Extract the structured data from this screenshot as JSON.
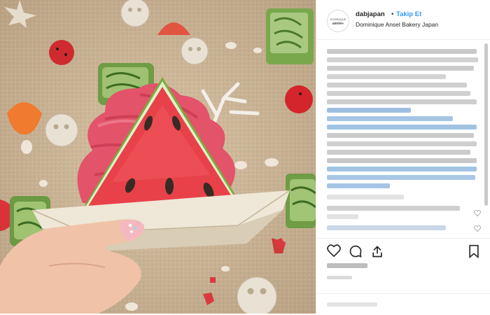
{
  "post": {
    "account_handle": "dabjapan",
    "separator": "•",
    "follow_label": "Takip Et",
    "location": "Dominique Ansel Bakery Japan",
    "avatar_text_top": "DOMINIQUE ANSEL",
    "avatar_text_bottom": "BAKERY",
    "likes_text": "",
    "date_text": "",
    "comment_placeholder": ""
  },
  "colors": {
    "follow": "#3897f0",
    "mention": "#1e6fc1"
  },
  "icons": {
    "like": "heart-icon",
    "comment": "comment-icon",
    "share": "share-icon",
    "save": "bookmark-icon"
  }
}
